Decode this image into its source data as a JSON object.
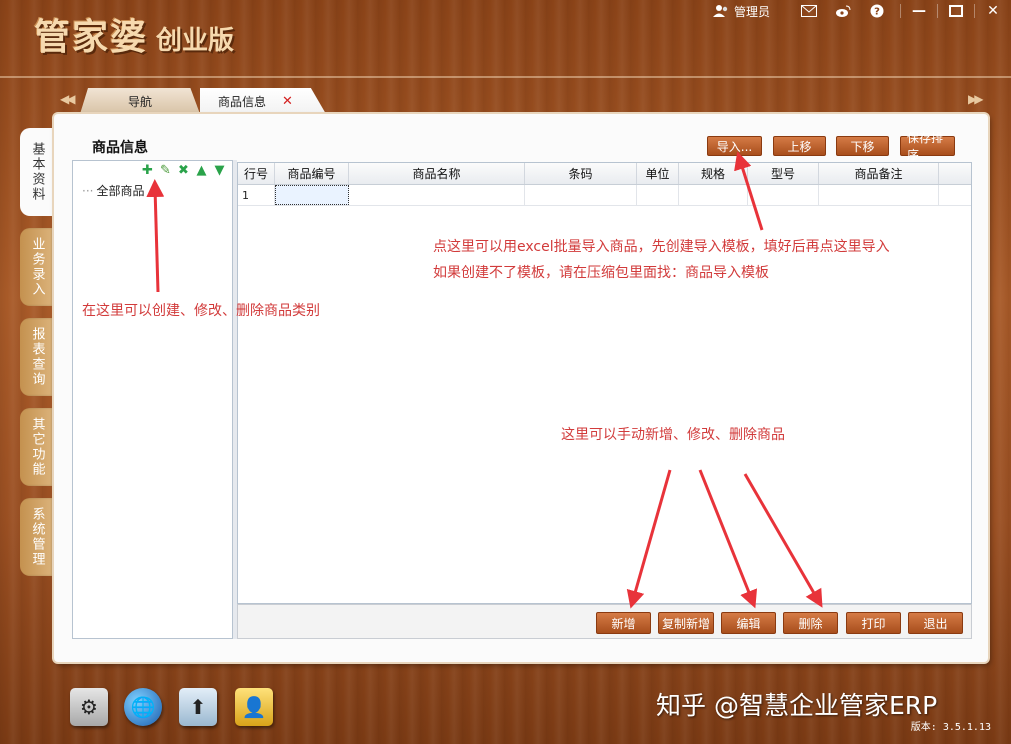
{
  "app": {
    "logo_main": "管家婆",
    "logo_sub": "创业版",
    "version": "版本: 3.5.1.13"
  },
  "topbar": {
    "user": "管理员"
  },
  "tabs": [
    {
      "label": "导航"
    },
    {
      "label": "商品信息"
    }
  ],
  "side_tabs": [
    "基本资料",
    "业务录入",
    "报表查询",
    "其它功能",
    "系统管理"
  ],
  "content": {
    "title": "商品信息"
  },
  "toolbar": {
    "import": "导入...",
    "move_up": "上移",
    "move_down": "下移",
    "save_order": "保存排序"
  },
  "tree": {
    "root": "全部商品",
    "tools": [
      "add-icon",
      "edit-icon",
      "delete-icon",
      "up-icon",
      "down-icon"
    ]
  },
  "grid": {
    "columns": [
      "行号",
      "商品编号",
      "商品名称",
      "条码",
      "单位",
      "规格",
      "型号",
      "商品备注"
    ],
    "rows": [
      {
        "row": "1"
      }
    ]
  },
  "bottom_buttons": {
    "add": "新增",
    "copy_add": "复制新增",
    "edit": "编辑",
    "delete": "删除",
    "print": "打印",
    "exit": "退出"
  },
  "annotations": {
    "import_line1": "点这里可以用excel批量导入商品，先创建导入模板，填好后再点这里导入",
    "import_line2": "如果创建不了模板，请在压缩包里面找：商品导入模板",
    "category": "在这里可以创建、修改、删除商品类别",
    "manual": "这里可以手动新增、修改、删除商品"
  },
  "watermark": "知乎 @智慧企业管家ERP",
  "colors": {
    "annotation": "#e8333a",
    "button": "#c0622e"
  }
}
